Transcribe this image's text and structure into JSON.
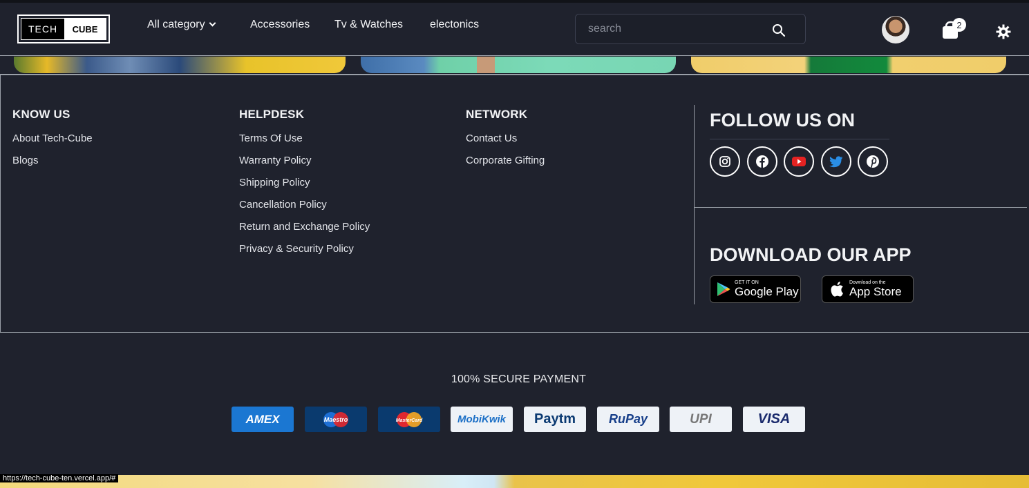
{
  "navbar": {
    "logo": {
      "left": "TECH",
      "right": "CUBE"
    },
    "links": [
      "All category",
      "Accessories",
      "Tv & Watches",
      "electonics"
    ],
    "search_placeholder": "search",
    "cart_count": "2"
  },
  "footer": {
    "know_us": {
      "title": "KNOW US",
      "links": [
        "About Tech-Cube",
        "Blogs"
      ]
    },
    "helpdesk": {
      "title": "HELPDESK",
      "links": [
        "Terms Of Use",
        "Warranty Policy",
        "Shipping Policy",
        "Cancellation Policy",
        "Return and Exchange Policy",
        "Privacy & Security Policy"
      ]
    },
    "network": {
      "title": "NETWORK",
      "links": [
        "Contact Us",
        "Corporate Gifting"
      ]
    },
    "follow_title": "FOLLOW US ON",
    "social": [
      "instagram",
      "facebook",
      "youtube",
      "twitter",
      "pinterest"
    ],
    "download_title": "DOWNLOAD OUR APP",
    "google_play": {
      "small": "GET IT ON",
      "big": "Google Play"
    },
    "app_store": {
      "small": "Download on the",
      "big": "App Store"
    }
  },
  "payment": {
    "title": "100% SECURE PAYMENT",
    "methods": [
      "AMEX",
      "Maestro",
      "MasterCard",
      "MobiKwik",
      "Paytm",
      "RuPay",
      "UPI",
      "VISA"
    ]
  },
  "status_url": "https://tech-cube-ten.vercel.app/#",
  "colors": {
    "background": "#1f222d",
    "amex": "#1b77d2",
    "card_dark": "#0a3a6e"
  }
}
